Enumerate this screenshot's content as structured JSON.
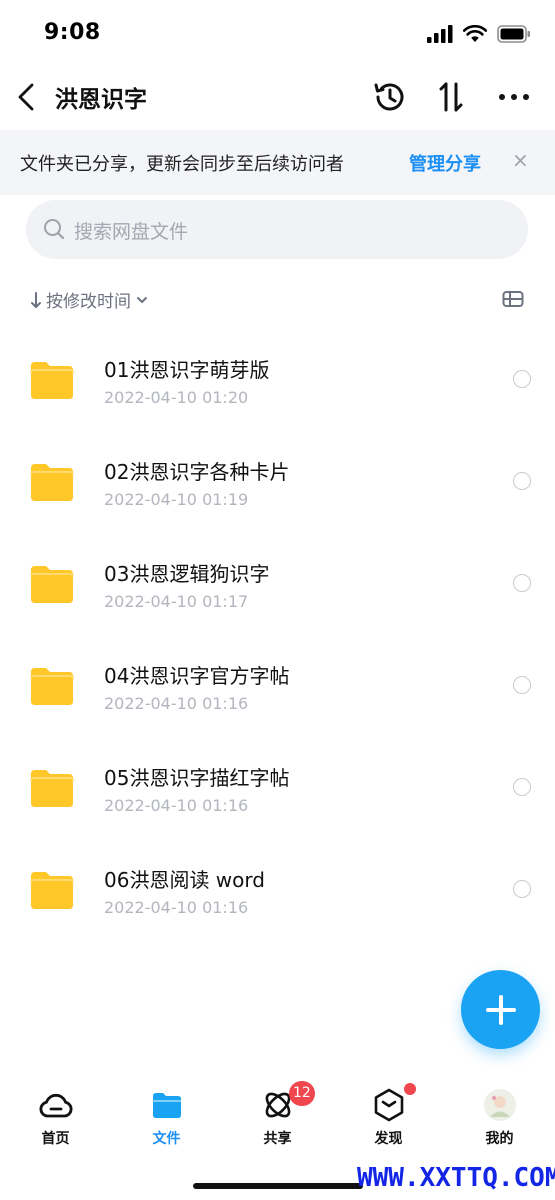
{
  "status_bar": {
    "time": "9:08"
  },
  "nav": {
    "title": "洪恩识字",
    "icons": [
      "back-icon",
      "history-icon",
      "sort-icon",
      "more-icon"
    ]
  },
  "share_banner": {
    "text": "文件夹已分享，更新会同步至后续访问者",
    "link": "管理分享",
    "close": "×"
  },
  "search": {
    "placeholder": "搜索网盘文件"
  },
  "sort": {
    "label": "按修改时间"
  },
  "files": [
    {
      "name": "01洪恩识字萌芽版",
      "date": "2022-04-10 01:20"
    },
    {
      "name": "02洪恩识字各种卡片",
      "date": "2022-04-10 01:19"
    },
    {
      "name": "03洪恩逻辑狗识字",
      "date": "2022-04-10 01:17"
    },
    {
      "name": "04洪恩识字官方字帖",
      "date": "2022-04-10 01:16"
    },
    {
      "name": "05洪恩识字描红字帖",
      "date": "2022-04-10 01:16"
    },
    {
      "name": "06洪恩阅读 word",
      "date": "2022-04-10 01:16"
    }
  ],
  "tabs": [
    {
      "label": "首页",
      "icon": "cloud-icon"
    },
    {
      "label": "文件",
      "icon": "folder-icon",
      "active": true
    },
    {
      "label": "共享",
      "icon": "share-icon",
      "badge": "12"
    },
    {
      "label": "发现",
      "icon": "discover-icon"
    },
    {
      "label": "我的",
      "icon": "avatar-icon"
    }
  ],
  "watermark": "WWW.XXTTQ.COM",
  "colors": {
    "accent": "#1a8ff5",
    "fab": "#1aa3f3",
    "folder": "#ffc727",
    "badge": "#f0474f"
  }
}
